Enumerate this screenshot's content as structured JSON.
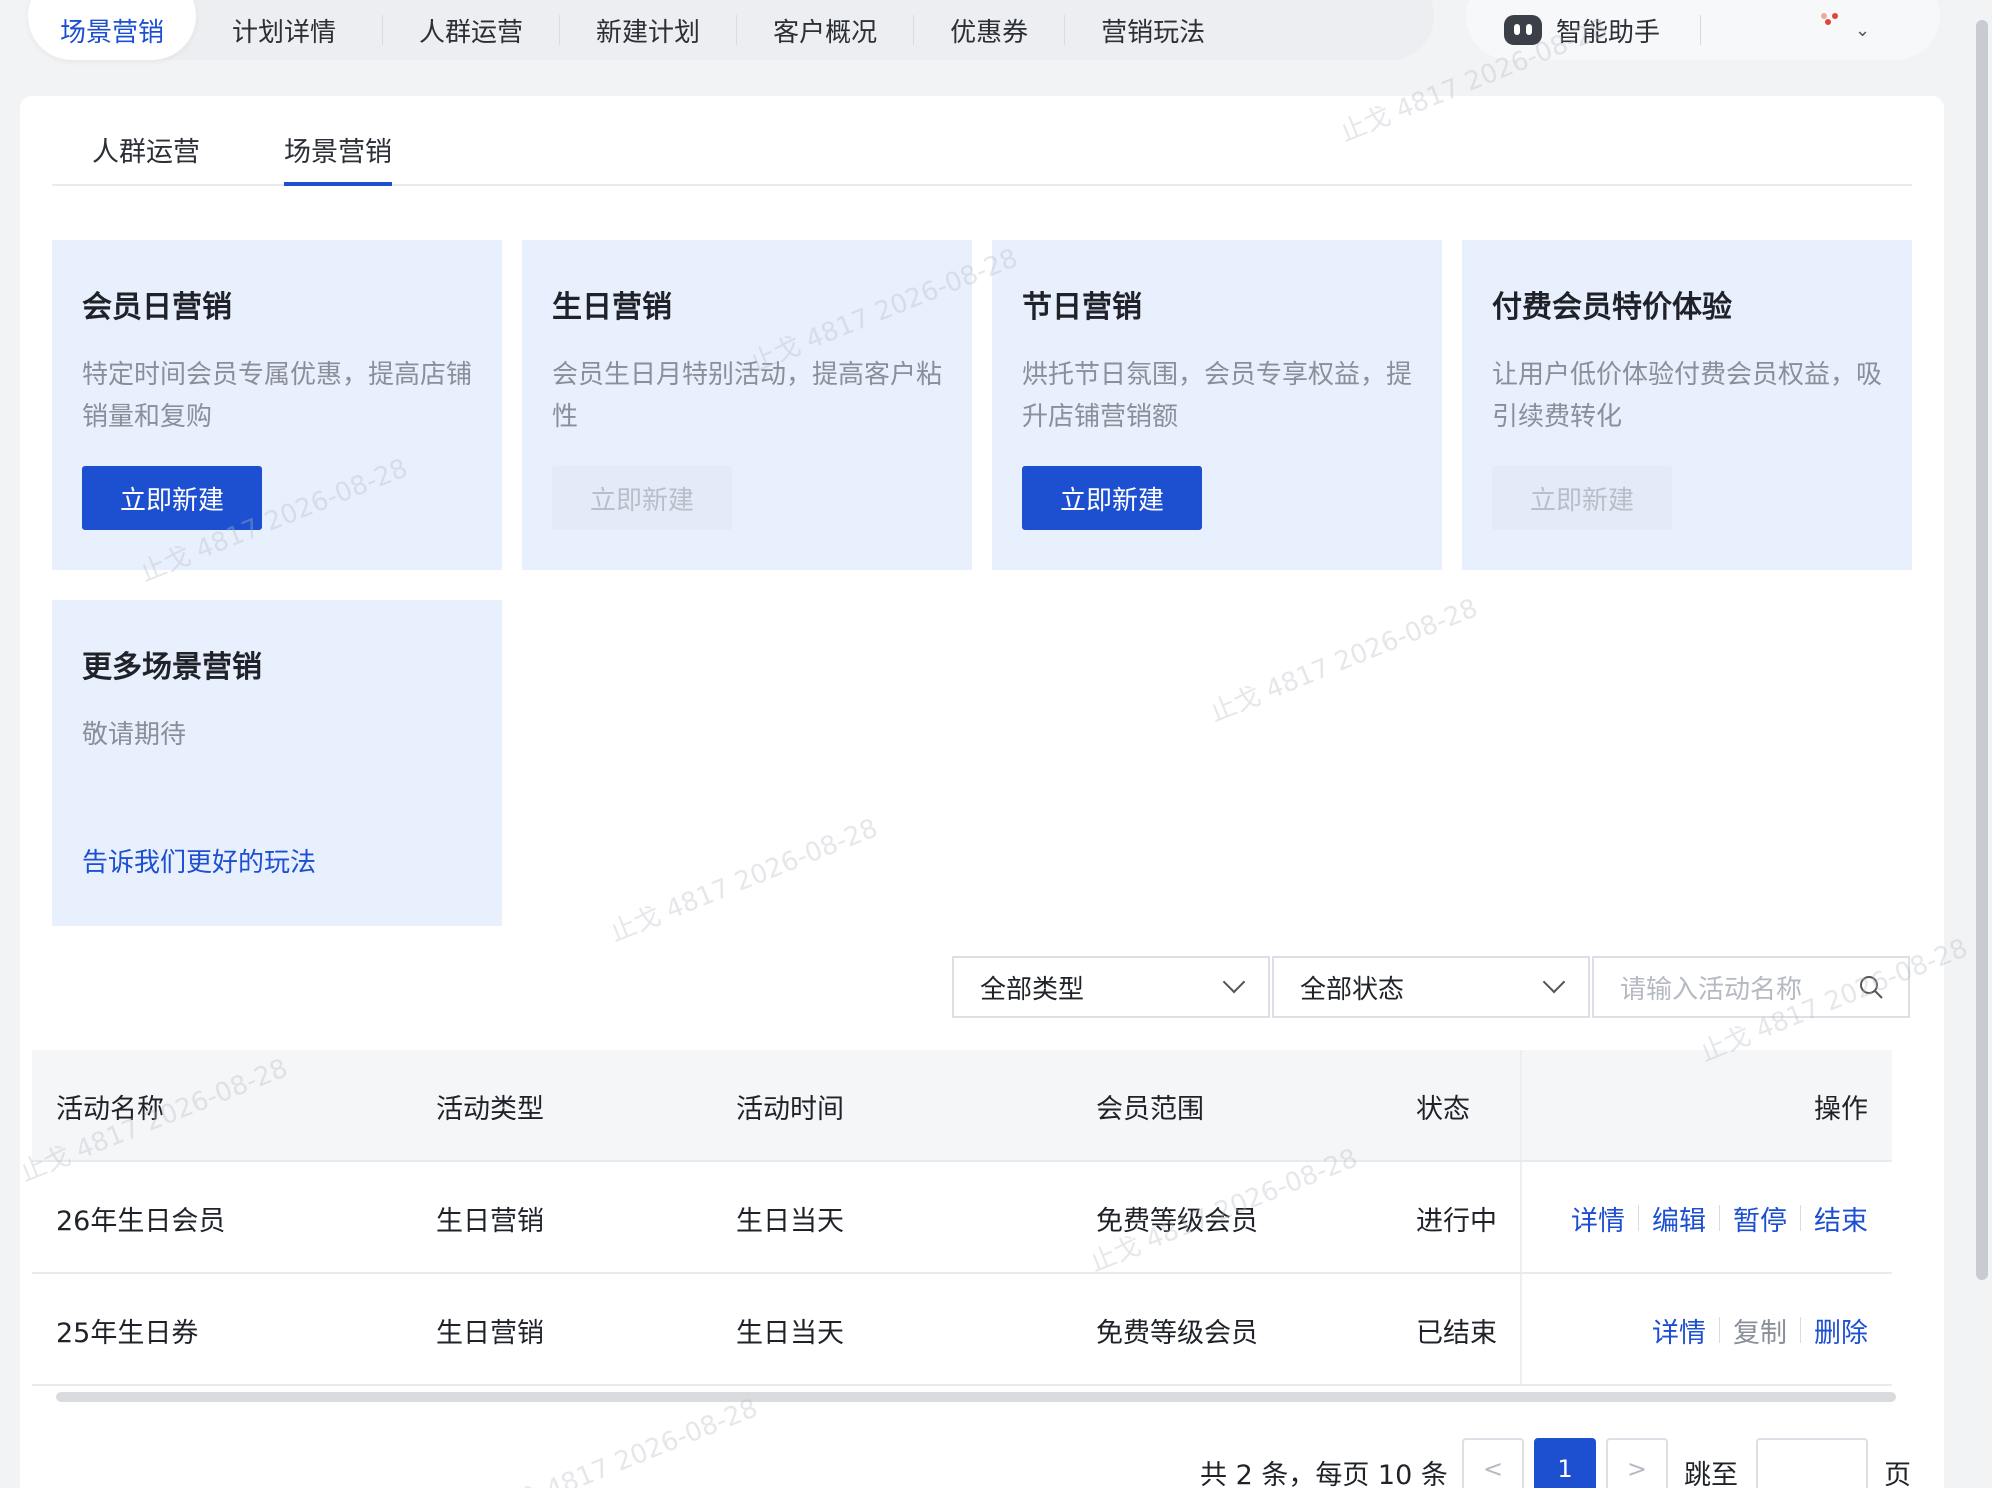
{
  "topnav": {
    "items": [
      "场景营销",
      "计划详情",
      "人群运营",
      "新建计划",
      "客户概况",
      "优惠券",
      "营销玩法"
    ],
    "assistant_label": "智能助手"
  },
  "tabs": [
    "人群运营",
    "场景营销"
  ],
  "cards": [
    {
      "title": "会员日营销",
      "desc": "特定时间会员专属优惠，提高店铺销量和复购",
      "button": "立即新建",
      "enabled": true
    },
    {
      "title": "生日营销",
      "desc": "会员生日月特别活动，提高客户粘性",
      "button": "立即新建",
      "enabled": false
    },
    {
      "title": "节日营销",
      "desc": "烘托节日氛围，会员专享权益，提升店铺营销额",
      "button": "立即新建",
      "enabled": true
    },
    {
      "title": "付费会员特价体验",
      "desc": "让用户低价体验付费会员权益，吸引续费转化",
      "button": "立即新建",
      "enabled": false
    }
  ],
  "more_card": {
    "title": "更多场景营销",
    "desc": "敬请期待",
    "link": "告诉我们更好的玩法"
  },
  "filters": {
    "type": "全部类型",
    "status": "全部状态",
    "search_placeholder": "请输入活动名称"
  },
  "table": {
    "headers": [
      "活动名称",
      "活动类型",
      "活动时间",
      "会员范围",
      "状态",
      "操作"
    ],
    "rows": [
      {
        "name": "26年生日会员",
        "type": "生日营销",
        "time": "生日当天",
        "scope": "免费等级会员",
        "status": "进行中",
        "ops": [
          "详情",
          "编辑",
          "暂停",
          "结束"
        ]
      },
      {
        "name": "25年生日券",
        "type": "生日营销",
        "time": "生日当天",
        "scope": "免费等级会员",
        "status": "已结束",
        "ops": [
          "详情",
          "复制",
          "删除"
        ]
      }
    ]
  },
  "pagination": {
    "summary": "共 2 条，每页 10 条",
    "prev": "<",
    "current": "1",
    "next": ">",
    "jump_label": "跳至",
    "page_suffix": "页"
  },
  "watermark": "止戈 4817 2026-08-28",
  "colors": {
    "primary": "#1d4fd1",
    "card_bg": "#e9f0fd"
  }
}
